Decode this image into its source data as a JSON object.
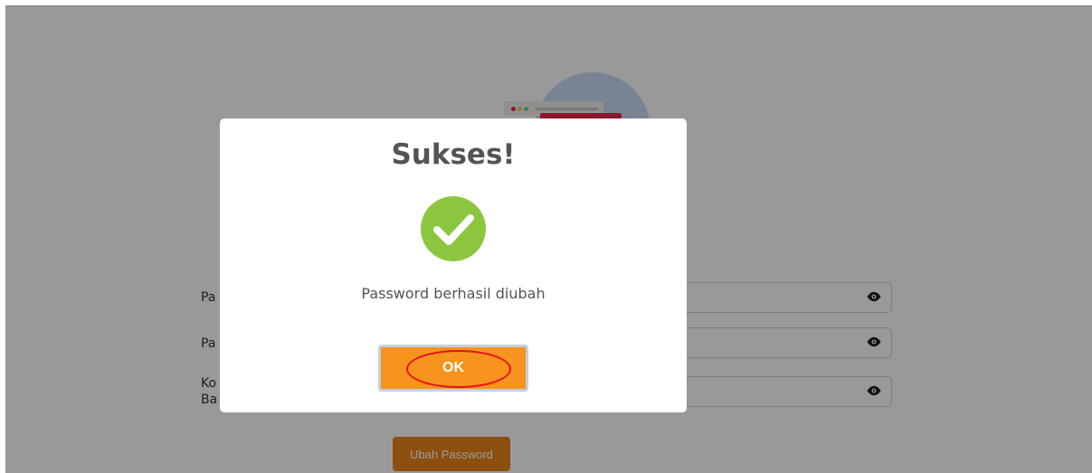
{
  "form": {
    "fields": [
      {
        "label": "Pa",
        "value": ""
      },
      {
        "label": "Pa",
        "value": ""
      },
      {
        "label": "Ko\nBa",
        "value": ""
      }
    ],
    "submit_label": "Ubah Password"
  },
  "modal": {
    "title": "Sukses!",
    "icon": "check-circle-icon",
    "message": "Password berhasil diubah",
    "ok_label": "OK"
  },
  "colors": {
    "accent": "#f7941d",
    "success": "#8cc63f",
    "highlight": "#e3141e"
  }
}
